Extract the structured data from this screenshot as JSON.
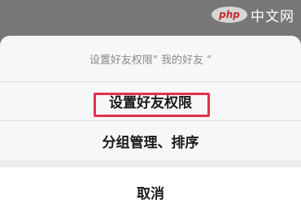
{
  "watermark": {
    "logo": "php",
    "text": "中文网"
  },
  "sheet": {
    "title": "设置好友权限\" 我的好友 \"",
    "options": [
      {
        "label": "设置好友权限"
      },
      {
        "label": "分组管理、排序"
      }
    ],
    "cancel_label": "取消"
  },
  "colors": {
    "highlight": "#e0324a",
    "overlay": "#777777",
    "sheet": "#f7f7f7"
  }
}
